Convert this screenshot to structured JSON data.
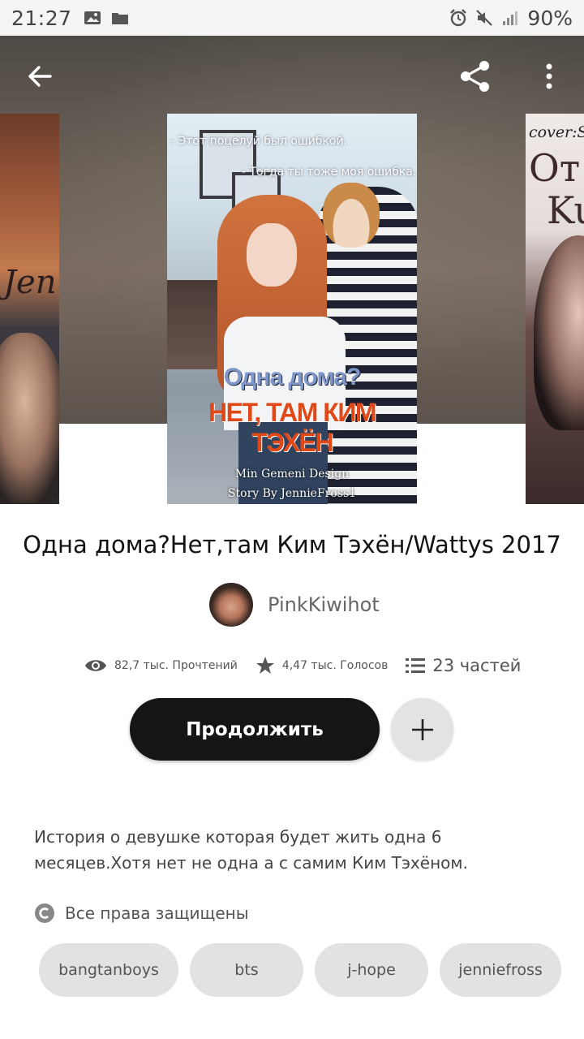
{
  "status_bar": {
    "time": "21:27",
    "battery": "90%"
  },
  "header": {
    "back_icon": "arrow-left-icon",
    "share_icon": "share-icon",
    "menu_icon": "more-vertical-icon"
  },
  "covers": {
    "main": {
      "quote_line1": "- Этот поцелуй был ошибкой.",
      "quote_line2": "- Тогда ты тоже моя ошибка.",
      "title_line1": "Одна дома?",
      "title_line2": "НЕТ, ТАМ КИМ ТЭХЁН",
      "credit_design": "Min Gemeni Design",
      "credit_story": "Story By JennieFross1"
    },
    "left": {
      "text": "Jen"
    },
    "right": {
      "credit": "cover:Se",
      "big_text": "От",
      "big_text2": "Ku"
    }
  },
  "story": {
    "title": "Одна дома?Нет,там Ким Тэхён/Wattys 2017",
    "author": "PinkKiwihot",
    "reads": "82,7 тыс. Прочтений",
    "votes": "4,47 тыс. Голосов",
    "parts": "23 частей",
    "continue_label": "Продолжить",
    "description": "История о девушке которая будет жить одна 6 месяцев.Хотя нет не одна а с самим Ким Тэхёном.",
    "copyright": "Все права защищены",
    "tags": [
      "bangtanboys",
      "bts",
      "j-hope",
      "jenniefross"
    ]
  },
  "colors": {
    "button_dark": "#151515",
    "chip_bg": "#e2e2e2",
    "accent_orange": "#e04818"
  }
}
